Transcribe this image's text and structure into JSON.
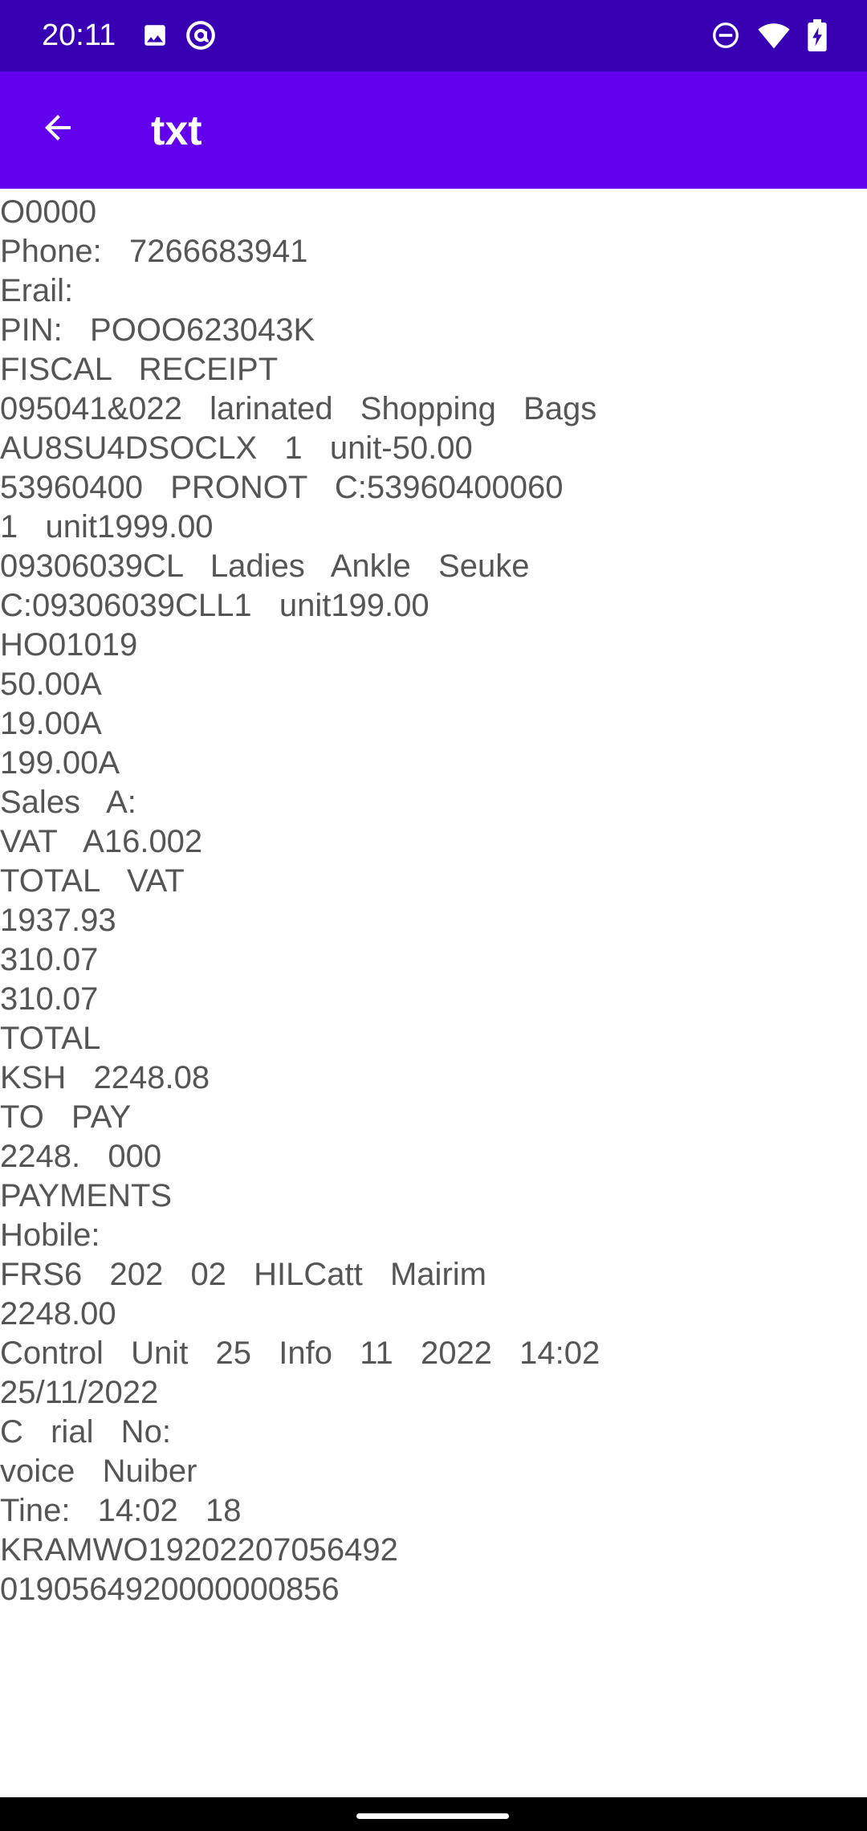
{
  "status_bar": {
    "time": "20:11",
    "left_icons": [
      "image-icon",
      "at-sign-icon"
    ],
    "right_icons": [
      "do-not-disturb-icon",
      "wifi-icon",
      "battery-charging-icon"
    ]
  },
  "app_bar": {
    "title": "txt"
  },
  "receipt_lines": [
    "O0000",
    "Phone:  7266683941",
    "Erail:",
    "PIN:  POOO623043K",
    "FISCAL  RECEIPT",
    "095041&022  larinated  Shopping  Bags",
    "AU8SU4DSOCLX  1  unit-50.00",
    "53960400  PRONOT  C:53960400060",
    "1  unit1999.00",
    "09306039CL  Ladies  Ankle  Seuke",
    "C:09306039CLL1  unit199.00",
    "HO01019",
    "50.00A",
    "19.00A",
    "199.00A",
    "Sales  A:",
    "VAT  A16.002",
    "TOTAL  VAT",
    "1937.93",
    "310.07",
    "310.07",
    "TOTAL",
    "KSH  2248.08",
    "TO  PAY",
    "2248.  000",
    "PAYMENTS",
    "Hobile:",
    "FRS6  202  02  HILCatt  Mairim",
    "2248.00",
    "Control  Unit  25  Info  11  2022  14:02",
    "25/11/2022",
    "C  rial  No:",
    "voice  Nuiber",
    "Tine:  14:02  18",
    "KRAMWO19202207056492",
    "0190564920000000856"
  ]
}
